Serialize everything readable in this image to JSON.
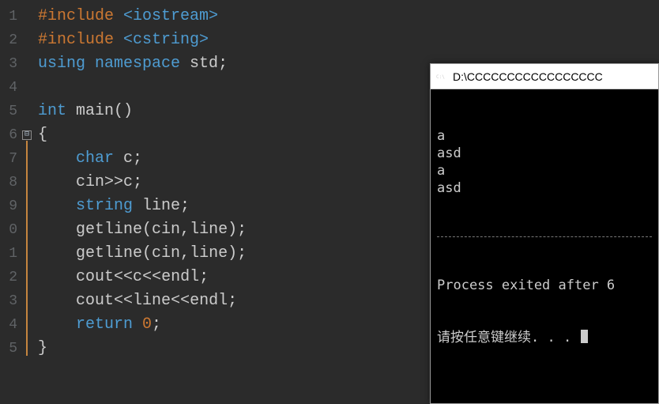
{
  "editor": {
    "lines": [
      {
        "num": "1",
        "fragments": [
          [
            "tok-preproc",
            "#include "
          ],
          [
            "tok-string",
            "<iostream>"
          ]
        ]
      },
      {
        "num": "2",
        "fragments": [
          [
            "tok-preproc",
            "#include "
          ],
          [
            "tok-string",
            "<cstring>"
          ]
        ]
      },
      {
        "num": "3",
        "fragments": [
          [
            "tok-keyword",
            "using "
          ],
          [
            "tok-keyword",
            "namespace "
          ],
          [
            "tok-ident",
            "std"
          ],
          [
            "tok-punct",
            ";"
          ]
        ]
      },
      {
        "num": "4",
        "fragments": []
      },
      {
        "num": "5",
        "fragments": [
          [
            "tok-type",
            "int "
          ],
          [
            "tok-ident",
            "main"
          ],
          [
            "tok-punct",
            "()"
          ]
        ]
      },
      {
        "num": "6",
        "fragments": [
          [
            "tok-punct",
            "{"
          ]
        ]
      },
      {
        "num": "7",
        "fragments": [
          [
            "",
            ""
          ],
          [
            "tok-type",
            "    char "
          ],
          [
            "tok-ident",
            "c"
          ],
          [
            "tok-punct",
            ";"
          ]
        ]
      },
      {
        "num": "8",
        "fragments": [
          [
            "",
            "    "
          ],
          [
            "tok-ident",
            "cin"
          ],
          [
            "tok-operator",
            ">>"
          ],
          [
            "tok-ident",
            "c"
          ],
          [
            "tok-punct",
            ";"
          ]
        ]
      },
      {
        "num": "9",
        "fragments": [
          [
            "",
            "    "
          ],
          [
            "tok-type",
            "string "
          ],
          [
            "tok-ident",
            "line"
          ],
          [
            "tok-punct",
            ";"
          ]
        ]
      },
      {
        "num": "0",
        "fragments": [
          [
            "",
            "    "
          ],
          [
            "tok-ident",
            "getline"
          ],
          [
            "tok-punct",
            "("
          ],
          [
            "tok-ident",
            "cin"
          ],
          [
            "tok-punct",
            ","
          ],
          [
            "tok-ident",
            "line"
          ],
          [
            "tok-punct",
            ")"
          ],
          [
            "tok-punct",
            ";"
          ]
        ]
      },
      {
        "num": "1",
        "fragments": [
          [
            "",
            "    "
          ],
          [
            "tok-ident",
            "getline"
          ],
          [
            "tok-punct",
            "("
          ],
          [
            "tok-ident",
            "cin"
          ],
          [
            "tok-punct",
            ","
          ],
          [
            "tok-ident",
            "line"
          ],
          [
            "tok-punct",
            ")"
          ],
          [
            "tok-punct",
            ";"
          ]
        ]
      },
      {
        "num": "2",
        "fragments": [
          [
            "",
            "    "
          ],
          [
            "tok-ident",
            "cout"
          ],
          [
            "tok-operator",
            "<<"
          ],
          [
            "tok-ident",
            "c"
          ],
          [
            "tok-operator",
            "<<"
          ],
          [
            "tok-ident",
            "endl"
          ],
          [
            "tok-punct",
            ";"
          ]
        ]
      },
      {
        "num": "3",
        "fragments": [
          [
            "",
            "    "
          ],
          [
            "tok-ident",
            "cout"
          ],
          [
            "tok-operator",
            "<<"
          ],
          [
            "tok-ident",
            "line"
          ],
          [
            "tok-operator",
            "<<"
          ],
          [
            "tok-ident",
            "endl"
          ],
          [
            "tok-punct",
            ";"
          ]
        ]
      },
      {
        "num": "4",
        "fragments": [
          [
            "",
            "    "
          ],
          [
            "tok-keyword",
            "return "
          ],
          [
            "tok-num",
            "0"
          ],
          [
            "tok-punct",
            ";"
          ]
        ]
      },
      {
        "num": "5",
        "fragments": [
          [
            "tok-punct",
            "}"
          ]
        ]
      }
    ],
    "fold_minimize": "⊟"
  },
  "console": {
    "title": "D:\\CCCCCCCCCCCCCCCCC",
    "output_lines": [
      "a",
      "asd",
      "a",
      "asd"
    ],
    "exit_msg": "Process exited after 6",
    "prompt_msg": "请按任意键继续. . . "
  }
}
